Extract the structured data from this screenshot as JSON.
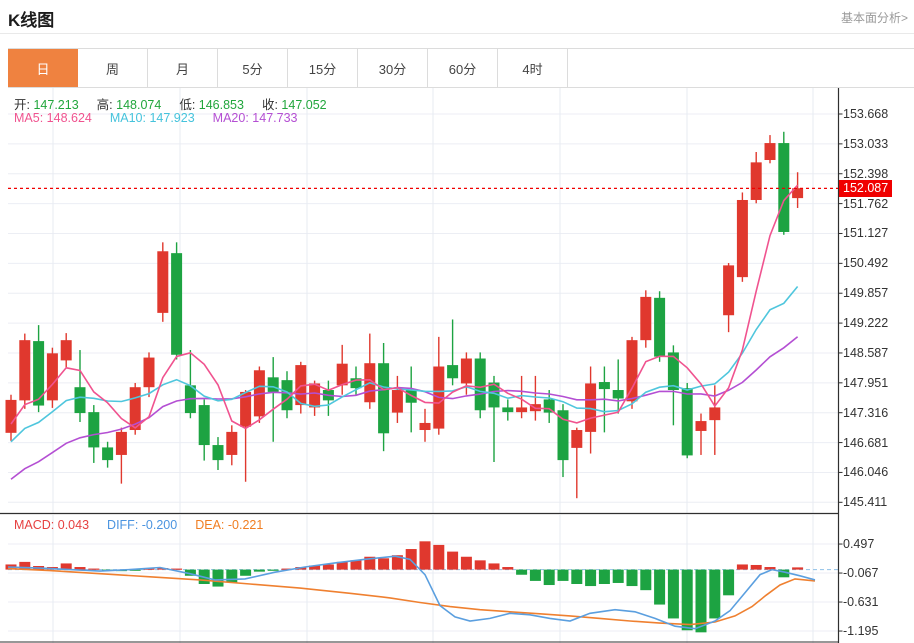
{
  "header": {
    "title": "K线图",
    "link": "基本面分析>"
  },
  "tabs": {
    "active_index": 0,
    "items": [
      {
        "label": "日",
        "name": "tab-day"
      },
      {
        "label": "周",
        "name": "tab-week"
      },
      {
        "label": "月",
        "name": "tab-month"
      },
      {
        "label": "5分",
        "name": "tab-5min"
      },
      {
        "label": "15分",
        "name": "tab-15min"
      },
      {
        "label": "30分",
        "name": "tab-30min"
      },
      {
        "label": "60分",
        "name": "tab-60min"
      },
      {
        "label": "4时",
        "name": "tab-4hour"
      }
    ]
  },
  "legend": {
    "ohlc": [
      {
        "label": "开:",
        "value": "147.213"
      },
      {
        "label": "高:",
        "value": "148.074"
      },
      {
        "label": "低:",
        "value": "146.853"
      },
      {
        "label": "收:",
        "value": "147.052"
      }
    ],
    "ma": [
      {
        "label": "MA5:",
        "value": "148.624",
        "color": "#f0538f"
      },
      {
        "label": "MA10:",
        "value": "147.923",
        "color": "#45c3dc"
      },
      {
        "label": "MA20:",
        "value": "147.733",
        "color": "#b44fd3"
      }
    ]
  },
  "macd_legend": [
    {
      "label": "MACD:",
      "value": "0.043",
      "color": "#e64040"
    },
    {
      "label": "DIFF:",
      "value": "-0.200",
      "color": "#4b94e0"
    },
    {
      "label": "DEA:",
      "value": "-0.221",
      "color": "#f07e22"
    }
  ],
  "colors": {
    "up": "#e0382e",
    "down": "#1da342",
    "ma5": "#f0538f",
    "ma10": "#4fc6dd",
    "ma20": "#b44fd3",
    "diff": "#5b9fdf",
    "dea": "#ef8030",
    "tab_active_bg": "#ef8240",
    "last_price": "#f00000",
    "grid": "#eceef4",
    "vgrid": "#e7ebf2",
    "ohlc_value": "#21a63c",
    "frame": "#2f2f2f",
    "zero_dash": "#8fc0e8"
  },
  "chart_data": {
    "type": "candlestick-with-macd",
    "title": "K线图",
    "price_axis": {
      "labels": [
        "153.668",
        "153.033",
        "152.398",
        "151.762",
        "151.127",
        "150.492",
        "149.857",
        "149.222",
        "148.587",
        "147.951",
        "147.316",
        "146.681",
        "146.046",
        "145.411"
      ],
      "top_value": 153.668,
      "step": 0.635,
      "last_price": "152.087",
      "last_price_value": 152.087
    },
    "macd_axis": {
      "labels": [
        "0.497",
        "-0.067",
        "-0.631",
        "-1.195"
      ],
      "top_value": 0.497,
      "step": 0.564
    },
    "candles_ohlc": [
      [
        146.89,
        147.7,
        146.72,
        147.59
      ],
      [
        147.58,
        149.0,
        147.4,
        148.86
      ],
      [
        148.84,
        149.18,
        147.33,
        147.47
      ],
      [
        147.58,
        148.7,
        147.42,
        148.58
      ],
      [
        148.43,
        149.01,
        148.28,
        148.86
      ],
      [
        147.86,
        148.65,
        147.12,
        147.31
      ],
      [
        147.33,
        147.48,
        146.25,
        146.58
      ],
      [
        146.58,
        146.7,
        146.15,
        146.31
      ],
      [
        146.42,
        147.0,
        145.81,
        146.91
      ],
      [
        146.95,
        147.95,
        146.85,
        147.86
      ],
      [
        147.86,
        148.6,
        147.65,
        148.49
      ],
      [
        149.44,
        150.94,
        149.25,
        150.75
      ],
      [
        150.71,
        150.94,
        148.45,
        148.55
      ],
      [
        147.9,
        148.65,
        147.2,
        147.31
      ],
      [
        147.48,
        147.6,
        146.3,
        146.63
      ],
      [
        146.63,
        146.8,
        146.1,
        146.31
      ],
      [
        146.42,
        147.05,
        146.2,
        146.91
      ],
      [
        147.02,
        147.8,
        145.85,
        147.76
      ],
      [
        147.24,
        148.3,
        147.1,
        148.22
      ],
      [
        148.07,
        148.5,
        146.7,
        147.76
      ],
      [
        148.01,
        148.2,
        147.2,
        147.37
      ],
      [
        147.48,
        148.4,
        147.3,
        148.33
      ],
      [
        147.43,
        148.0,
        147.25,
        147.94
      ],
      [
        147.8,
        148.0,
        147.25,
        147.58
      ],
      [
        147.9,
        148.76,
        147.7,
        148.36
      ],
      [
        148.05,
        148.3,
        147.7,
        147.84
      ],
      [
        147.54,
        149.0,
        147.4,
        148.37
      ],
      [
        148.37,
        148.8,
        146.5,
        146.88
      ],
      [
        147.32,
        148.1,
        147.1,
        147.8
      ],
      [
        147.8,
        148.3,
        146.9,
        147.53
      ],
      [
        146.95,
        147.4,
        146.7,
        147.1
      ],
      [
        146.98,
        148.93,
        146.85,
        148.3
      ],
      [
        148.33,
        149.3,
        147.9,
        148.05
      ],
      [
        147.94,
        148.6,
        147.7,
        148.47
      ],
      [
        148.47,
        148.6,
        147.2,
        147.37
      ],
      [
        147.96,
        148.1,
        146.27,
        147.43
      ],
      [
        147.43,
        147.6,
        147.15,
        147.33
      ],
      [
        147.33,
        148.1,
        147.2,
        147.43
      ],
      [
        147.35,
        148.1,
        147.15,
        147.5
      ],
      [
        147.6,
        147.8,
        147.1,
        147.32
      ],
      [
        147.37,
        147.5,
        145.95,
        146.31
      ],
      [
        146.57,
        147.0,
        145.5,
        146.95
      ],
      [
        146.91,
        148.3,
        146.45,
        147.94
      ],
      [
        147.97,
        148.3,
        146.9,
        147.82
      ],
      [
        147.8,
        148.45,
        147.3,
        147.62
      ],
      [
        147.56,
        148.93,
        147.4,
        148.86
      ],
      [
        148.86,
        149.92,
        148.7,
        149.78
      ],
      [
        149.76,
        149.9,
        148.4,
        148.51
      ],
      [
        148.6,
        148.75,
        147.05,
        147.8
      ],
      [
        147.84,
        147.95,
        146.35,
        146.41
      ],
      [
        146.93,
        147.3,
        146.42,
        147.14
      ],
      [
        147.16,
        147.9,
        146.42,
        147.43
      ],
      [
        149.39,
        150.5,
        149.03,
        150.45
      ],
      [
        150.2,
        152.0,
        150.1,
        151.84
      ],
      [
        151.84,
        152.86,
        151.77,
        152.64
      ],
      [
        152.69,
        153.22,
        152.62,
        153.05
      ],
      [
        153.05,
        153.29,
        151.1,
        151.16
      ],
      [
        151.88,
        152.43,
        151.67,
        152.09
      ]
    ],
    "ma_prehistory_closes": [
      144.2,
      144.4,
      144.5,
      144.7,
      144.9,
      145.0,
      145.2,
      145.4,
      145.5,
      145.7,
      145.8,
      146.0,
      146.2,
      146.3,
      146.5,
      146.6,
      146.8,
      146.9,
      147.0,
      147.1
    ],
    "macd_histogram": [
      0.1,
      0.15,
      0.07,
      0.05,
      0.12,
      0.05,
      0.02,
      -0.02,
      -0.03,
      -0.02,
      0.02,
      0.03,
      0.02,
      -0.12,
      -0.28,
      -0.33,
      -0.25,
      -0.12,
      -0.04,
      -0.02,
      0.02,
      0.05,
      0.08,
      0.1,
      0.15,
      0.18,
      0.25,
      0.22,
      0.28,
      0.4,
      0.55,
      0.48,
      0.35,
      0.25,
      0.18,
      0.12,
      0.05,
      -0.1,
      -0.22,
      -0.3,
      -0.22,
      -0.28,
      -0.32,
      -0.28,
      -0.26,
      -0.32,
      -0.4,
      -0.68,
      -0.95,
      -1.18,
      -1.22,
      -0.95,
      -0.5,
      0.1,
      0.09,
      0.05,
      -0.15,
      0.043
    ],
    "diff_line": [
      [
        8,
        0.05
      ],
      [
        40,
        0.03
      ],
      [
        70,
        0.0
      ],
      [
        100,
        -0.03
      ],
      [
        130,
        0.0
      ],
      [
        160,
        0.04
      ],
      [
        190,
        -0.08
      ],
      [
        215,
        -0.2
      ],
      [
        245,
        -0.18
      ],
      [
        275,
        -0.05
      ],
      [
        305,
        0.05
      ],
      [
        335,
        0.13
      ],
      [
        365,
        0.2
      ],
      [
        395,
        0.26
      ],
      [
        410,
        0.2
      ],
      [
        425,
        -0.1
      ],
      [
        440,
        -0.7
      ],
      [
        455,
        -0.92
      ],
      [
        470,
        -1.0
      ],
      [
        490,
        -0.95
      ],
      [
        510,
        -0.85
      ],
      [
        530,
        -0.88
      ],
      [
        550,
        -0.95
      ],
      [
        570,
        -1.0
      ],
      [
        590,
        -0.85
      ],
      [
        615,
        -0.78
      ],
      [
        635,
        -0.82
      ],
      [
        655,
        -0.95
      ],
      [
        675,
        -1.1
      ],
      [
        695,
        -1.15
      ],
      [
        715,
        -1.0
      ],
      [
        730,
        -0.8
      ],
      [
        745,
        -0.45
      ],
      [
        760,
        -0.1
      ],
      [
        772,
        0.0
      ],
      [
        785,
        -0.05
      ],
      [
        800,
        -0.12
      ],
      [
        815,
        -0.2
      ]
    ],
    "dea_line": [
      [
        8,
        0.02
      ],
      [
        50,
        -0.02
      ],
      [
        100,
        -0.08
      ],
      [
        150,
        -0.14
      ],
      [
        200,
        -0.2
      ],
      [
        250,
        -0.28
      ],
      [
        300,
        -0.36
      ],
      [
        350,
        -0.46
      ],
      [
        390,
        -0.55
      ],
      [
        420,
        -0.64
      ],
      [
        450,
        -0.72
      ],
      [
        480,
        -0.78
      ],
      [
        510,
        -0.82
      ],
      [
        540,
        -0.86
      ],
      [
        570,
        -0.9
      ],
      [
        600,
        -0.95
      ],
      [
        630,
        -1.0
      ],
      [
        660,
        -1.04
      ],
      [
        690,
        -1.07
      ],
      [
        715,
        -1.02
      ],
      [
        735,
        -0.9
      ],
      [
        752,
        -0.72
      ],
      [
        766,
        -0.5
      ],
      [
        780,
        -0.3
      ],
      [
        795,
        -0.18
      ],
      [
        815,
        -0.22
      ]
    ]
  }
}
